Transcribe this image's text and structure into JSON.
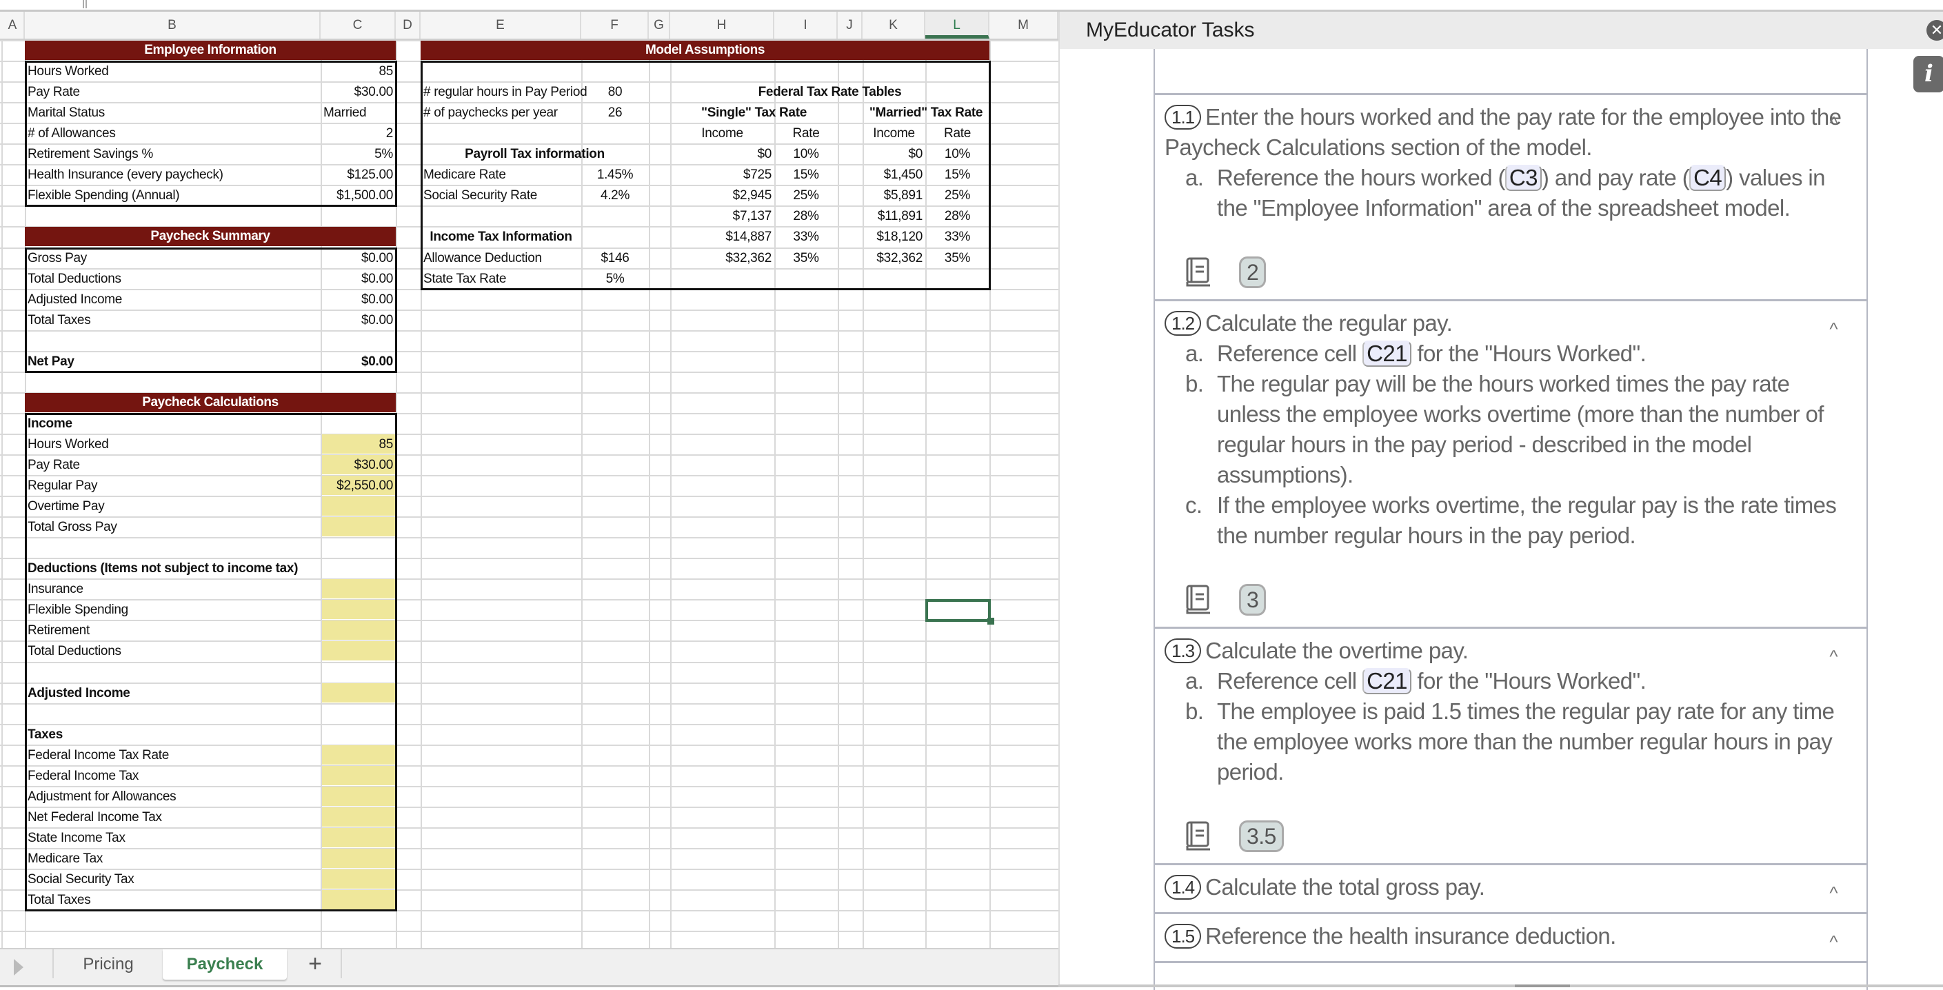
{
  "window": {
    "title_fragment": ""
  },
  "sheet": {
    "columns": [
      "A",
      "B",
      "C",
      "D",
      "E",
      "F",
      "G",
      "H",
      "I",
      "J",
      "K",
      "L",
      "M"
    ],
    "selected_column": "L",
    "employee_info": {
      "title": "Employee Information",
      "rows": [
        {
          "label": "Hours Worked",
          "value": "85"
        },
        {
          "label": "Pay Rate",
          "value": "$30.00"
        },
        {
          "label": "Marital Status",
          "value": "Married"
        },
        {
          "label": "# of Allowances",
          "value": "2"
        },
        {
          "label": "Retirement Savings %",
          "value": "5%"
        },
        {
          "label": "Health Insurance (every paycheck)",
          "value": "$125.00"
        },
        {
          "label": "Flexible Spending (Annual)",
          "value": "$1,500.00"
        }
      ]
    },
    "paycheck_summary": {
      "title": "Paycheck Summary",
      "rows": [
        {
          "label": "Gross Pay",
          "value": "$0.00"
        },
        {
          "label": "Total Deductions",
          "value": "$0.00"
        },
        {
          "label": "Adjusted Income",
          "value": "$0.00"
        },
        {
          "label": "Total Taxes",
          "value": "$0.00"
        }
      ],
      "net_pay": {
        "label": "Net Pay",
        "value": "$0.00"
      }
    },
    "paycheck_calculations": {
      "title": "Paycheck Calculations",
      "income_header": "Income",
      "income_rows": [
        {
          "label": "Hours Worked",
          "value": "85"
        },
        {
          "label": "Pay Rate",
          "value": "$30.00"
        },
        {
          "label": "Regular Pay",
          "value": "$2,550.00"
        },
        {
          "label": "Overtime Pay",
          "value": ""
        },
        {
          "label": "Total Gross Pay",
          "value": ""
        }
      ],
      "deductions_header": "Deductions (Items not subject to income tax)",
      "deduction_rows": [
        {
          "label": "Insurance",
          "value": ""
        },
        {
          "label": "Flexible Spending",
          "value": ""
        },
        {
          "label": "Retirement",
          "value": ""
        },
        {
          "label": "Total Deductions",
          "value": ""
        }
      ],
      "adjusted_income": {
        "label": "Adjusted Income",
        "value": ""
      },
      "taxes_header": "Taxes",
      "tax_rows": [
        {
          "label": "Federal Income Tax Rate",
          "value": ""
        },
        {
          "label": "Federal Income Tax",
          "value": ""
        },
        {
          "label": "Adjustment for Allowances",
          "value": ""
        },
        {
          "label": "Net Federal Income Tax",
          "value": ""
        },
        {
          "label": "State Income Tax",
          "value": ""
        },
        {
          "label": "Medicare Tax",
          "value": ""
        },
        {
          "label": "Social Security Tax",
          "value": ""
        },
        {
          "label": "Total Taxes",
          "value": ""
        }
      ]
    },
    "model_assumptions": {
      "title": "Model Assumptions",
      "regular_hours": {
        "label": "# regular hours in Pay Period",
        "value": "80"
      },
      "paychecks_per_year": {
        "label": "# of paychecks per year",
        "value": "26"
      },
      "payroll_tax_header": "Payroll Tax information",
      "medicare": {
        "label": "Medicare Rate",
        "value": "1.45%"
      },
      "social_security": {
        "label": "Social Security Rate",
        "value": "4.2%"
      },
      "income_tax_header": "Income Tax Information",
      "allowance_deduction": {
        "label": "Allowance Deduction",
        "value": "$146"
      },
      "state_tax": {
        "label": "State Tax Rate",
        "value": "5%"
      },
      "federal_tables": {
        "title": "Federal Tax Rate Tables",
        "single_title": "\"Single\" Tax Rate",
        "married_title": "\"Married\" Tax Rate",
        "income_label": "Income",
        "rate_label": "Rate",
        "single": [
          {
            "income": "$0",
            "rate": "10%"
          },
          {
            "income": "$725",
            "rate": "15%"
          },
          {
            "income": "$2,945",
            "rate": "25%"
          },
          {
            "income": "$7,137",
            "rate": "28%"
          },
          {
            "income": "$14,887",
            "rate": "33%"
          },
          {
            "income": "$32,362",
            "rate": "35%"
          }
        ],
        "married": [
          {
            "income": "$0",
            "rate": "10%"
          },
          {
            "income": "$1,450",
            "rate": "15%"
          },
          {
            "income": "$5,891",
            "rate": "25%"
          },
          {
            "income": "$11,891",
            "rate": "28%"
          },
          {
            "income": "$18,120",
            "rate": "33%"
          },
          {
            "income": "$32,362",
            "rate": "35%"
          }
        ]
      }
    },
    "tabs": [
      {
        "label": "Pricing",
        "active": false
      },
      {
        "label": "Paycheck",
        "active": true
      }
    ],
    "add_tab_label": "+"
  },
  "panel": {
    "title": "MyEducator Tasks",
    "close_icon": "close-icon",
    "info_icon_label": "i",
    "tasks": [
      {
        "num": "1.1",
        "title": "Enter the hours worked and the pay rate for the employee into the Paycheck Calculations section of the model.",
        "subs": [
          {
            "lbl": "a.",
            "parts": [
              "Reference the hours worked (",
              {
                "ref": "C3"
              },
              ") and pay rate (",
              {
                "ref": "C4"
              },
              ") values in the \"Employee Information\" area of the spreadsheet model."
            ]
          }
        ],
        "points": "2"
      },
      {
        "num": "1.2",
        "title": "Calculate the regular pay.",
        "subs": [
          {
            "lbl": "a.",
            "parts": [
              "Reference cell ",
              {
                "ref": "C21"
              },
              " for the \"Hours Worked\"."
            ]
          },
          {
            "lbl": "b.",
            "parts": [
              "The regular pay will be the hours worked times the pay rate unless the employee works overtime (more than the number of regular hours in the pay period - described in the model assumptions)."
            ]
          },
          {
            "lbl": "c.",
            "parts": [
              "If the employee works overtime, the regular pay is the rate times the number regular hours in the pay period."
            ]
          }
        ],
        "points": "3"
      },
      {
        "num": "1.3",
        "title": "Calculate the overtime pay.",
        "subs": [
          {
            "lbl": "a.",
            "parts": [
              "Reference cell ",
              {
                "ref": "C21"
              },
              " for the \"Hours Worked\"."
            ]
          },
          {
            "lbl": "b.",
            "parts": [
              "The employee is paid 1.5 times the regular pay rate for any time the employee works more than the number regular hours in pay period."
            ]
          }
        ],
        "points": "3.5"
      },
      {
        "num": "1.4",
        "title": "Calculate the total gross pay.",
        "subs": [],
        "points": null
      },
      {
        "num": "1.5",
        "title": "Reference the health insurance deduction.",
        "subs": [],
        "points": null
      }
    ]
  },
  "colors": {
    "banner": "#741510",
    "input_fill": "#efe79b",
    "selection": "#3a7350"
  }
}
